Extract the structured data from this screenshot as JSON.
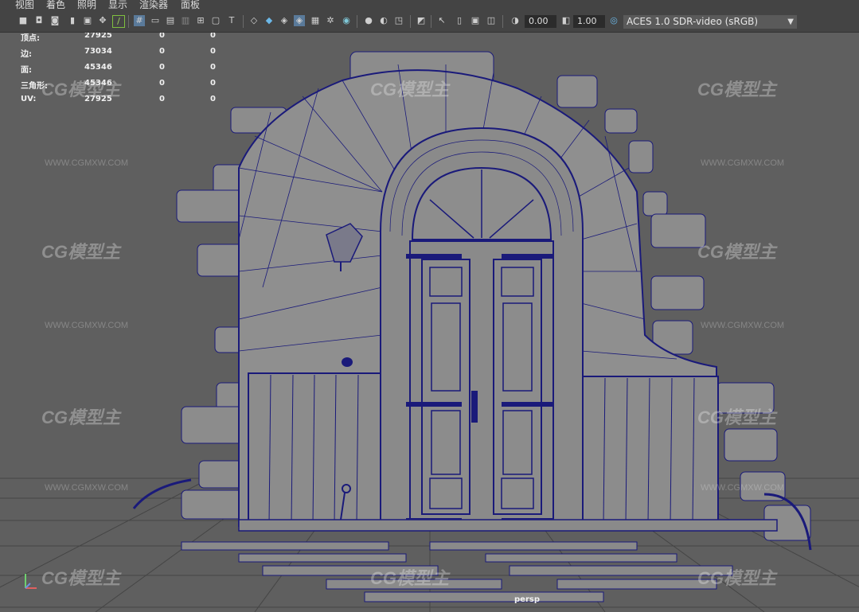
{
  "menu": [
    "视图",
    "着色",
    "照明",
    "显示",
    "渲染器",
    "面板"
  ],
  "toolbar": {
    "exposure": "0.00",
    "gamma": "1.00",
    "color_space": "ACES 1.0 SDR-video (sRGB)"
  },
  "hud": [
    {
      "label": "顶点:",
      "v1": "27925",
      "v2": "0",
      "v3": "0"
    },
    {
      "label": "边:",
      "v1": "73034",
      "v2": "0",
      "v3": "0"
    },
    {
      "label": "面:",
      "v1": "45346",
      "v2": "0",
      "v3": "0"
    },
    {
      "label": "三角形:",
      "v1": "45346",
      "v2": "0",
      "v3": "0"
    },
    {
      "label": "UV:",
      "v1": "27925",
      "v2": "0",
      "v3": "0"
    }
  ],
  "watermark": {
    "logo": "CG模型主",
    "url": "WWW.CGMXW.COM"
  },
  "camera": "persp",
  "colors": {
    "wire": "#1a1a7a",
    "surface": "#8a8a8a",
    "viewport": "#5f5f5f",
    "grid": "#3a3a3a"
  }
}
